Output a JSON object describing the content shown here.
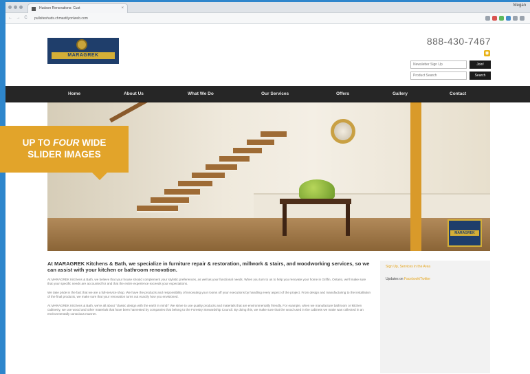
{
  "browser": {
    "tab_title": "Hudson Renovations: Cust",
    "tab_close": "×",
    "profile_label": "Megan",
    "nav_buttons": "← → C",
    "url": "pullsiteshuds.chmastilyonlweb.com"
  },
  "site": {
    "logo_text": "MARAGREK",
    "phone": "888-430-7467",
    "newsletter_placeholder": "Newsletter Sign Up",
    "join_button": "Join!",
    "search_placeholder": "Product Search",
    "search_button": "Search",
    "rss_icon": "rss-icon"
  },
  "nav": {
    "items": [
      "Home",
      "About Us",
      "What We Do",
      "Our Services",
      "Offers",
      "Gallery",
      "Contact"
    ]
  },
  "slider": {
    "logo_text": "MARAGREK"
  },
  "content": {
    "heading": "At MARAGREK Kitchens & Bath, we specialize in furniture repair & restoration, millwork & stairs, and woodworking services, so we can assist with your kitchen or bathroom renovation.",
    "paragraphs": [
      "At MARAGREK Kitchens & Bath, we believe that your house should complement your stylistic preferences, as well as your functional needs. When you turn to us to help you renovate your home in Griffin, Ontario, we'll make sure that your specific needs are accounted for and that the entire experience exceeds your expectations.",
      "We take pride in the fact that we are a full-service shop. We have the products and responsibility of innovating your rooms off your executions by handling every aspect of the project. From design and manufacturing to the installation of the final products, we make sure that your renovation turns out exactly how you envisioned.",
      "At MARAGREK Kitchens & Bath, we're all about \"classic design with the earth in mind!\" We strive to use quality products and materials that are environmentally friendly. For example, when we manufacture bathroom or kitchen cabinetry, we use wood and other materials that have been harvested by companies that belong to the Forestry Stewardship Council. By doing this, we make sure that the wood used in the cabinets we make was collected in an environmentally conscious manner."
    ]
  },
  "aside": {
    "heading": "Sign Up, Services in the Area",
    "updates_prefix": "Updates on",
    "updates_link": "Facebook/Twitter"
  },
  "callout": {
    "line1_pre": "UP TO ",
    "line1_em": "FOUR",
    "line1_post": " WIDE",
    "line2": "SLIDER IMAGES"
  },
  "colors": {
    "page_bg": "#2e86cc",
    "nav_bg": "#262626",
    "accent": "#e2a42a",
    "logo_blue": "#1f3e6b",
    "logo_gold": "#d4af37"
  }
}
